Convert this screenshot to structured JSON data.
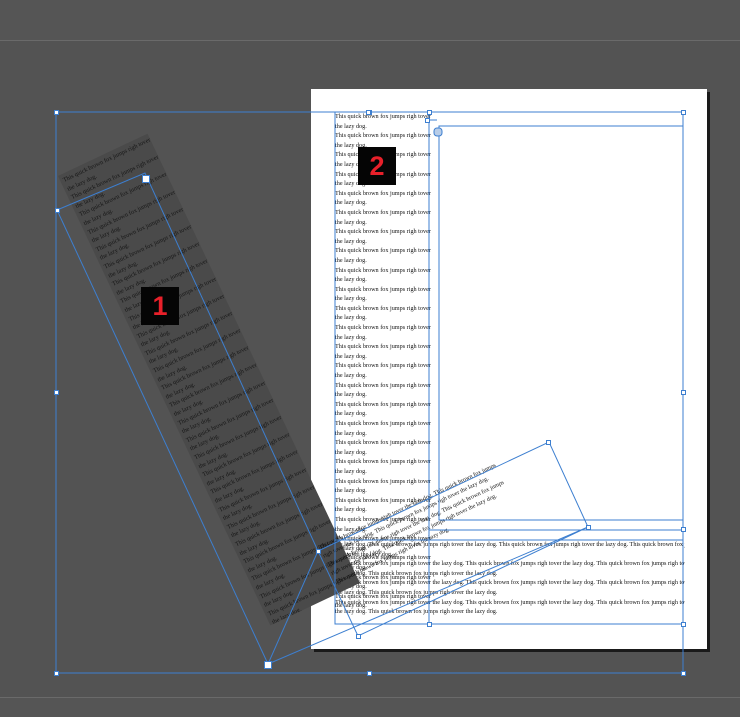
{
  "document": {
    "repeat_sentence": "This quick brown fox jumps righ tover the lazy dog.",
    "column_lines": [
      "This quick brown fox jumps righ tover",
      "the lazy dog.",
      "This quick brown fox jumps righ tover",
      "the lazy dog.",
      "This quick brown fox jumps righ tover",
      "the lazy dog.",
      "This quick brown fox jumps righ tover",
      "the lazy dog.",
      "This quick brown fox jumps righ tover",
      "the lazy dog.",
      "This quick brown fox jumps righ tover",
      "the lazy dog.",
      "This quick brown fox jumps righ tover",
      "the lazy dog.",
      "This quick brown fox jumps righ tover",
      "the lazy dog.",
      "This quick brown fox jumps righ tover",
      "the lazy dog.",
      "This quick brown fox jumps righ tover",
      "the lazy dog.",
      "This quick brown fox jumps righ tover",
      "the lazy dog.",
      "This quick brown fox jumps righ tover",
      "the lazy dog.",
      "This quick brown fox jumps righ tover",
      "the lazy dog.",
      "This quick brown fox jumps righ tover",
      "the lazy dog.",
      "This quick brown fox jumps righ tover",
      "the lazy dog.",
      "This quick brown fox jumps righ tover",
      "the lazy dog.",
      "This quick brown fox jumps righ tover",
      "the lazy dog.",
      "This quick brown fox jumps righ tover",
      "the lazy dog.",
      "This quick brown fox jumps righ tover",
      "the lazy dog.",
      "This quick brown fox jumps righ tover",
      "the lazy dog.",
      "This quick brown fox jumps righ tover",
      "the lazy dog.",
      "This quick brown fox jumps righ tover",
      "the lazy dog.",
      "This quick brown fox jumps righ tover",
      "the lazy dog.",
      "This quick brown fox jumps righ tover",
      "the lazy dog.",
      "This quick brown fox jumps righ tover",
      "the lazy dog.",
      "This quick brown fox jumps righ tover",
      "the lazy dog."
    ],
    "wide_lines": [
      "the lazy dog. This quick brown fox jumps righ tover the lazy dog. This quick brown fox jumps righ tover the lazy dog. This quick brown fox jumps",
      "righ tover the lazy dog.",
      "This quick brown fox jumps righ tover the lazy dog. This quick brown fox jumps righ tover the lazy dog. This quick brown fox jumps righ tover",
      "the lazy dog. This quick brown fox jumps righ tover the lazy dog.",
      "This quick brown fox jumps righ tover the lazy dog. This quick brown fox jumps righ tover the lazy dog. This quick brown fox jumps righ tover",
      "the lazy dog. This quick brown fox jumps righ tover the lazy dog.",
      "This quick brown fox jumps righ tover the lazy dog. This quick brown fox jumps righ tover the lazy dog. This quick brown fox jumps righ tover",
      "the lazy dog. This quick brown fox jumps righ tover the lazy dog."
    ],
    "rotated_wide_lines": [
      "This quick brown fox jumps righ tover the lazy dog. This quick brown fox jumps",
      "righ tover the lazy dog. This quick brown fox jumps righ tover the lazy dog.",
      "This quick brown fox jumps righ tover the lazy dog. This quick brown fox jumps",
      "righ tover the lazy dog. This quick brown fox jumps righ tover the lazy dog.",
      "This quick brown fox jumps righ tover the lazy dog."
    ]
  },
  "labels": {
    "frame_1": "1",
    "frame_2": "2"
  },
  "colors": {
    "canvas": "#535353",
    "page": "#ffffff",
    "selection": "#3d7fd0",
    "label_text": "#e8202a",
    "label_bg": "#050505",
    "rotated_frame_fill": "#4a4a4a"
  }
}
